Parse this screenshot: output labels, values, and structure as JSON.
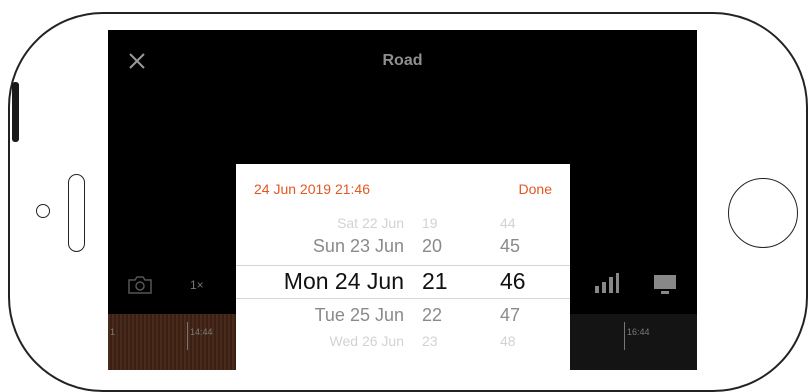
{
  "screen": {
    "title": "Road",
    "zoom_label": "1×"
  },
  "timeline": {
    "labels": [
      "1",
      "14:44",
      "16:44"
    ]
  },
  "picker": {
    "selected_datetime": "24 Jun 2019 21:46",
    "done_label": "Done",
    "rows": [
      {
        "day": "Sat 22 Jun",
        "hour": "19",
        "minute": "44"
      },
      {
        "day": "Sun 23 Jun",
        "hour": "20",
        "minute": "45"
      },
      {
        "day": "Mon 24 Jun",
        "hour": "21",
        "minute": "46"
      },
      {
        "day": "Tue 25 Jun",
        "hour": "22",
        "minute": "47"
      },
      {
        "day": "Wed 26 Jun",
        "hour": "23",
        "minute": "48"
      }
    ]
  },
  "colors": {
    "accent": "#e25822",
    "screen_bg": "#000000",
    "selected_text": "#111111",
    "faded_text": "#8a8a8a"
  },
  "icons": [
    "close-icon",
    "camera-icon",
    "signal-icon",
    "monitor-icon"
  ]
}
